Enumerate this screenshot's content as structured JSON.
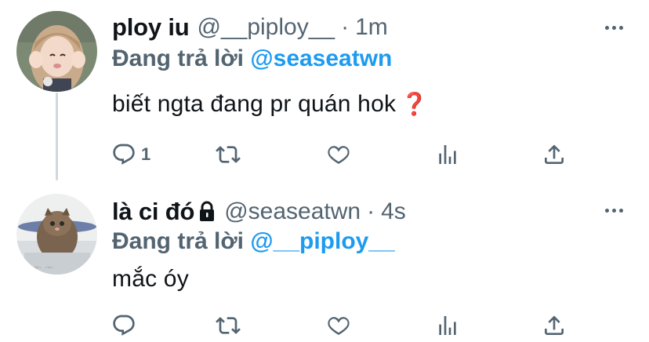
{
  "tweets": [
    {
      "name": "ploy iu",
      "handle": "@__piploy__",
      "dot": "·",
      "time": "1m",
      "replying_label": "Đang trả lời",
      "replying_to": "@seaseatwn",
      "text": "biết ngta đang pr quán hok",
      "emoji": "❓",
      "reply_count": "1",
      "protected": false
    },
    {
      "name": "là ci đó",
      "handle": "@seaseatwn",
      "dot": "·",
      "time": "4s",
      "replying_label": "Đang trả lời",
      "replying_to": "@__piploy__",
      "text": "mắc óy",
      "reply_count": "",
      "protected": true
    }
  ],
  "colors": {
    "accent": "#1d9bf0",
    "secondary_text": "#536471",
    "primary_text": "#0f1419",
    "thread_line": "#cfd9de"
  },
  "icons": [
    "reply-icon",
    "retweet-icon",
    "like-icon",
    "stats-icon",
    "share-icon",
    "more-icon",
    "lock-icon"
  ]
}
